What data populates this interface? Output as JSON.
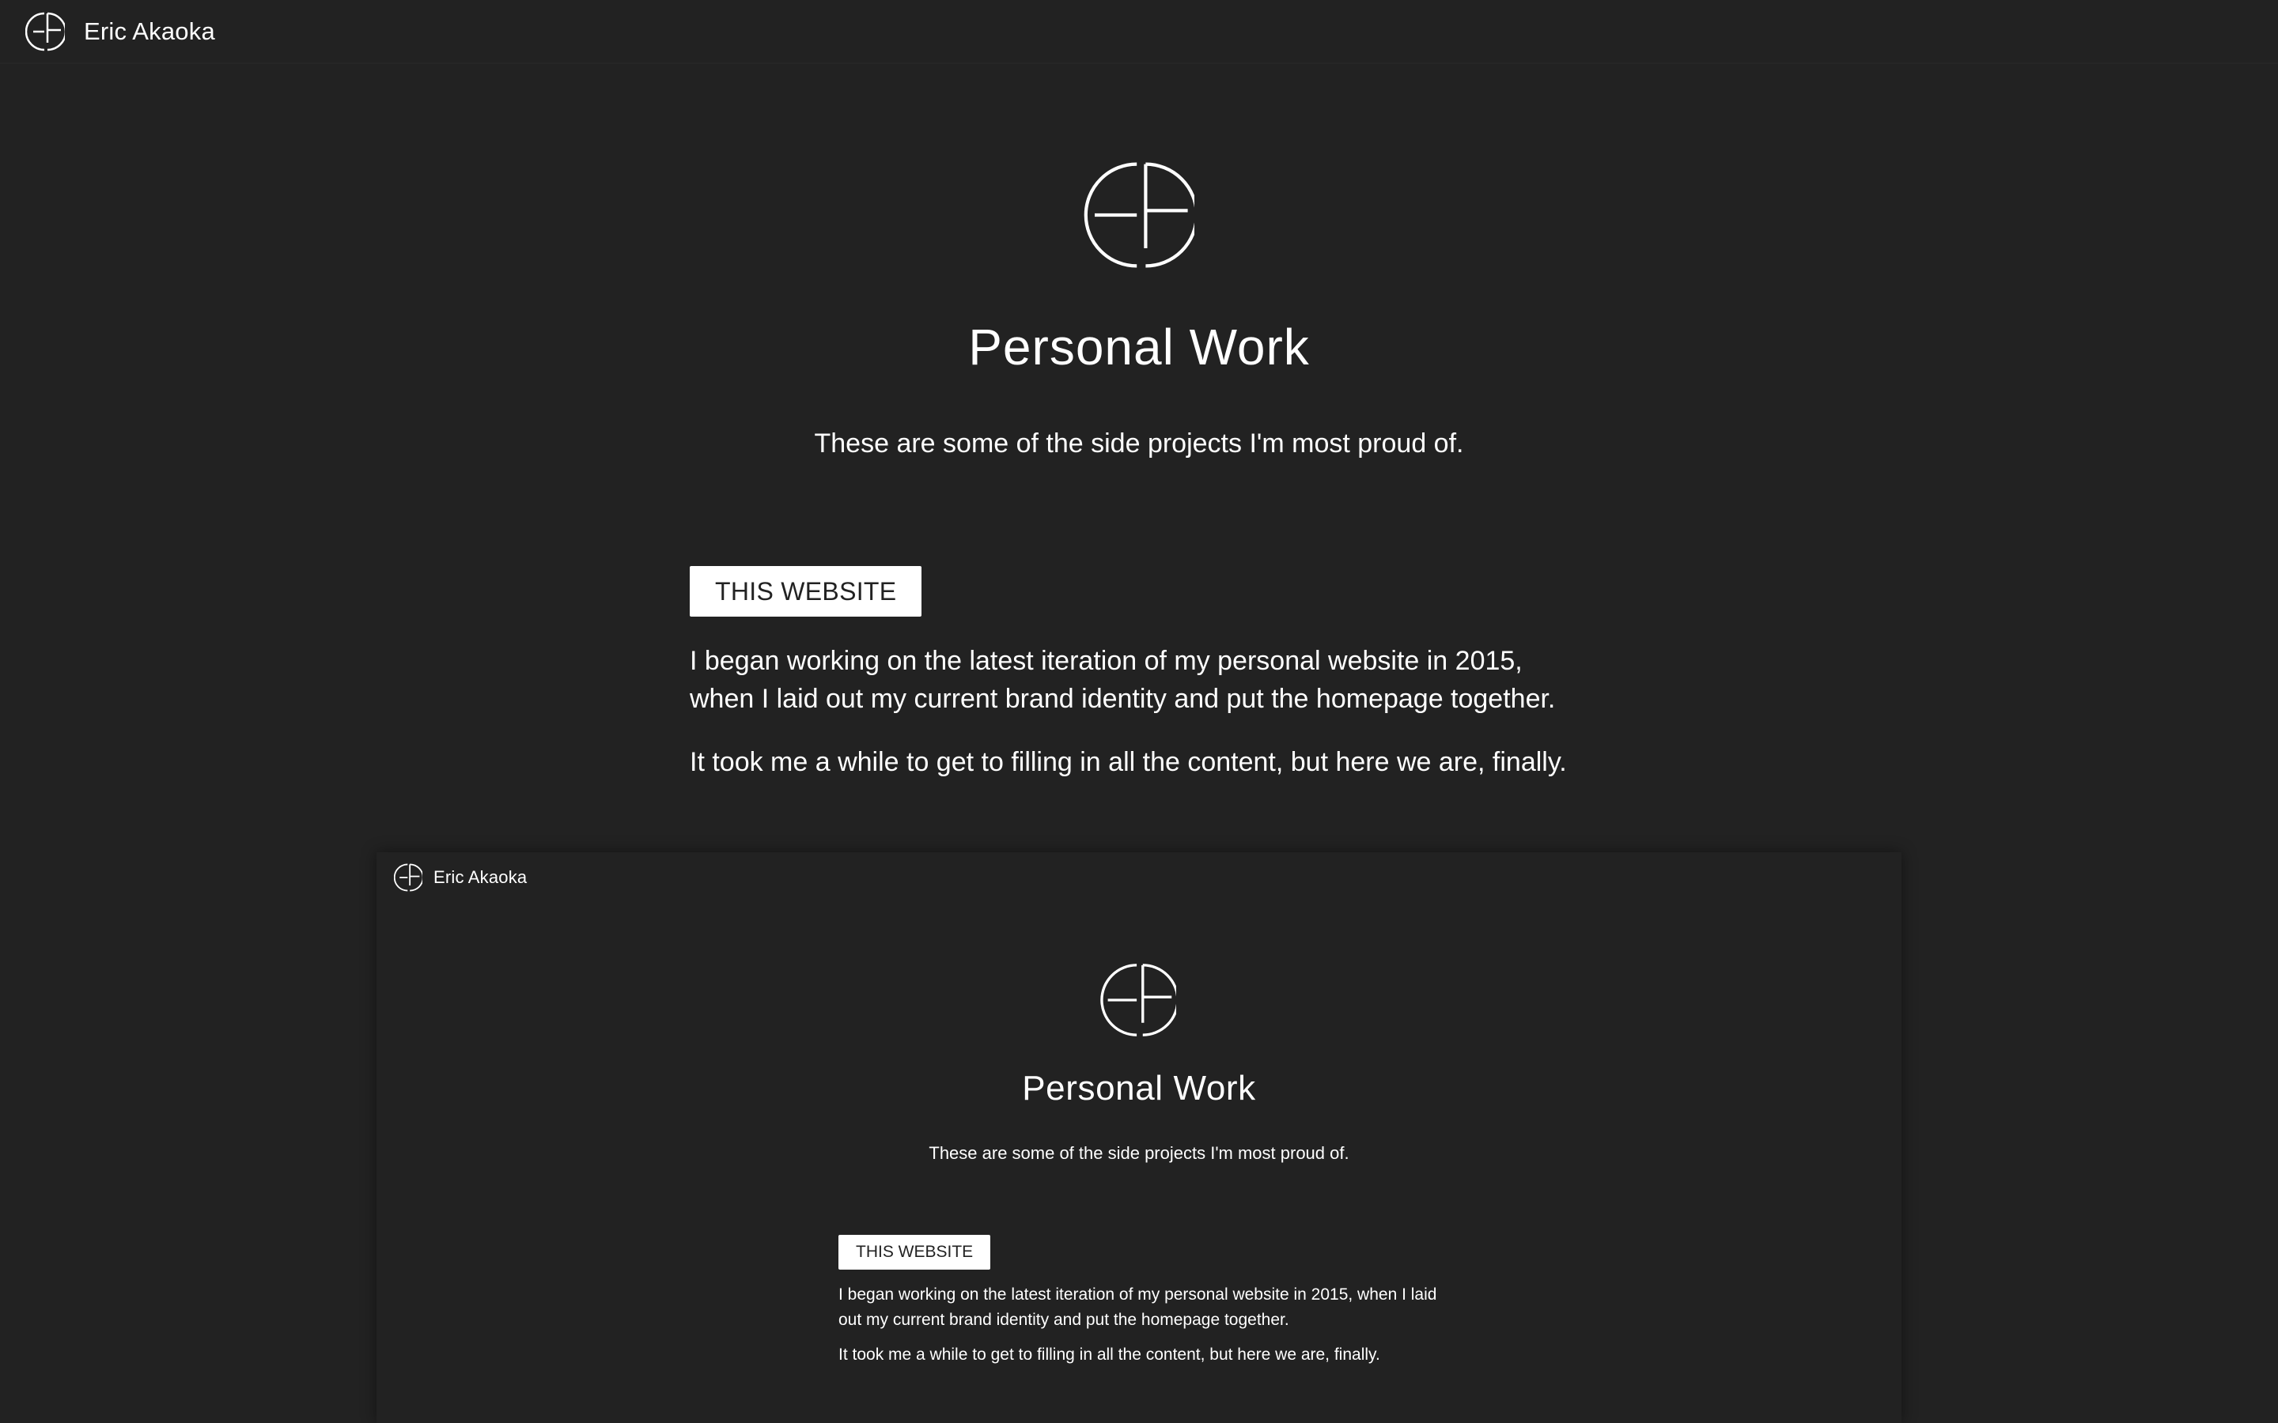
{
  "nav": {
    "logo_icon": "ea-monogram-icon",
    "brand_name": "Eric Akaoka"
  },
  "hero": {
    "logo_icon": "ea-monogram-icon",
    "title": "Personal Work",
    "subtitle": "These are some of the side projects I'm most proud of."
  },
  "project": {
    "tag": "THIS WEBSITE",
    "paragraphs": [
      "I began working on the latest iteration of my personal website in 2015, when I laid out my current brand identity and put the homepage together.",
      "It took me a while to get to filling in all the content, but here we are, finally."
    ]
  },
  "preview": {
    "nav_brand_name": "Eric Akaoka",
    "title": "Personal Work",
    "subtitle": "These are some of the side projects I'm most proud of.",
    "tag": "THIS WEBSITE",
    "paragraphs": [
      "I began working on the latest iteration of my personal website in 2015, when I laid out my current brand identity and put the homepage together.",
      "It took me a while to get to filling in all the content, but here we are, finally."
    ]
  },
  "colors": {
    "background": "#222222",
    "text": "#ffffff",
    "tag_background": "#ffffff",
    "tag_text": "#222222"
  }
}
